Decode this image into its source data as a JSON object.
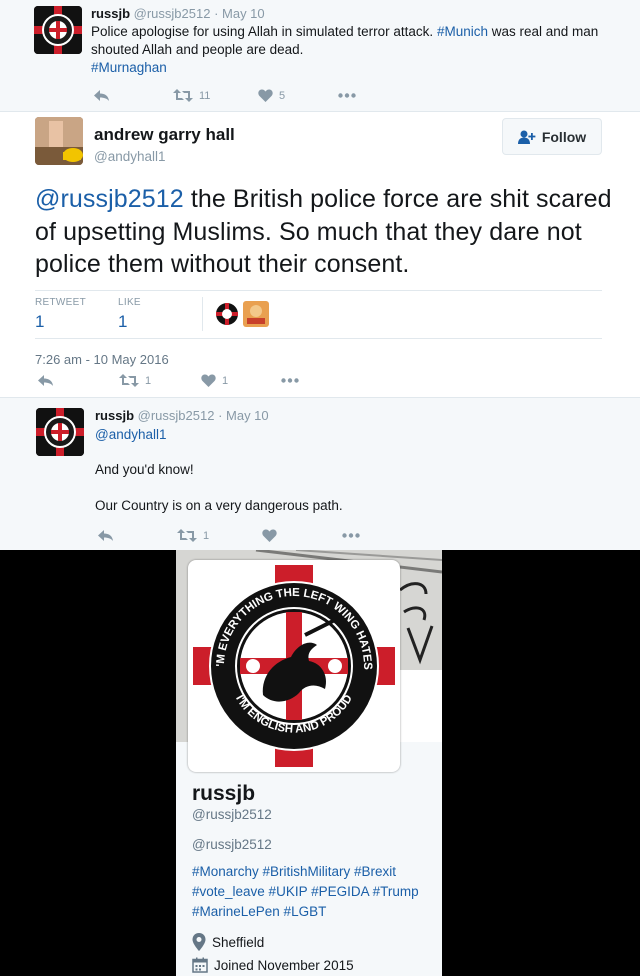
{
  "tweet1": {
    "name": "russjb",
    "handle": "@russjb2512",
    "date": "· May 10",
    "text_prefix": "Police apologise for using Allah in simulated terror attack. ",
    "hashtag_munich": "#Munich",
    "text_mid": " was real and man shouted Allah and people are dead.",
    "hashtag_murnaghan": "#Murnaghan",
    "retweets": "11",
    "likes": "5"
  },
  "tweet2": {
    "name": "andrew garry hall",
    "handle": "@andyhall1",
    "follow_label": "Follow",
    "mention": "@russjb2512",
    "text": " the British police force are shit scared of upsetting Muslims. So much that they dare not police them without their consent.",
    "retweet_label": "RETWEET",
    "like_label": "LIKE",
    "retweet_count": "1",
    "like_count": "1",
    "timestamp": "7:26 am - 10 May 2016",
    "action_retweets": "1",
    "action_likes": "1"
  },
  "tweet3": {
    "name": "russjb",
    "handle": "@russjb2512",
    "date": "· May 10",
    "mention": "@andyhall1",
    "line1": "And you'd know!",
    "line2": "Our Country is on a very dangerous path.",
    "retweets": "1"
  },
  "profile": {
    "badge_top": "I'M EVERYTHING THE LEFT WING HATES",
    "badge_bottom": "I'M ENGLISH AND PROUD",
    "name": "russjb",
    "handle": "@russjb2512",
    "handle_repeat": "@russjb2512",
    "bio_line1": "#Monarchy #BritishMilitary #Brexit",
    "bio_line2": "#vote_leave #UKIP #PEGIDA #Trump",
    "bio_line3": "#MarineLePen #LGBT",
    "location": "Sheffield",
    "joined": "Joined November 2015"
  },
  "colors": {
    "link": "#1b5fa8",
    "muted": "#8899a6",
    "cross_red": "#cc1e2a"
  },
  "icons": [
    "reply-icon",
    "retweet-icon",
    "heart-icon",
    "more-icon",
    "follow-person-icon",
    "location-pin-icon",
    "calendar-icon"
  ]
}
